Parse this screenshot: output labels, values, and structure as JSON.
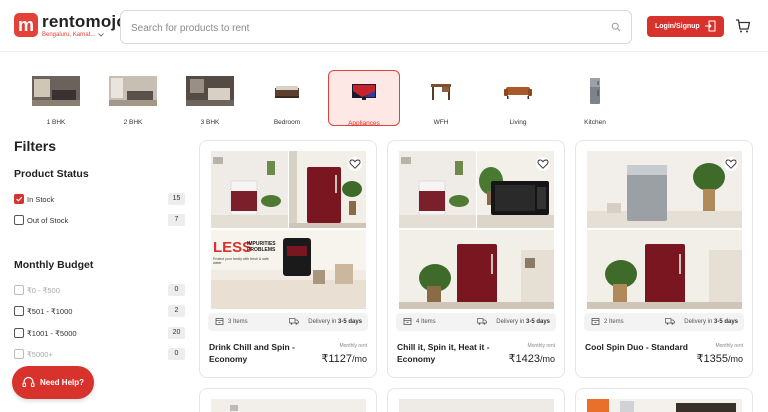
{
  "header": {
    "brand": "rentomojo",
    "logo_letter": "m",
    "city": "Bengaluru, Karnat...",
    "search_placeholder": "Search for products to rent",
    "login_label": "Login/Signup"
  },
  "categories": [
    {
      "label": "1 BHK"
    },
    {
      "label": "2 BHK"
    },
    {
      "label": "3 BHK"
    },
    {
      "label": "Bedroom"
    },
    {
      "label": "Appliances",
      "active": true
    },
    {
      "label": "WFH"
    },
    {
      "label": "Living"
    },
    {
      "label": "Kitchen"
    }
  ],
  "filters": {
    "title": "Filters",
    "product_status": {
      "title": "Product Status",
      "options": [
        {
          "label": "In Stock",
          "count": "15",
          "checked": true
        },
        {
          "label": "Out of Stock",
          "count": "7",
          "checked": false
        }
      ]
    },
    "monthly_budget": {
      "title": "Monthly Budget",
      "options": [
        {
          "label": "₹0 - ₹500",
          "count": "0",
          "disabled": true
        },
        {
          "label": "₹501 - ₹1000",
          "count": "2"
        },
        {
          "label": "₹1001 - ₹5000",
          "count": "20"
        },
        {
          "label": "₹5000+",
          "count": "0",
          "disabled": true
        }
      ]
    }
  },
  "help": {
    "label": "Need Help?"
  },
  "products": [
    {
      "name": "Drink Chill and Spin - Economy",
      "items": "3 Items",
      "delivery_prefix": "Delivery in",
      "delivery_days": "3-5 days",
      "monthly_label": "Monthly rent",
      "price": "₹1127",
      "per": "/mo",
      "banner_big": "LESS",
      "banner_small": "IMPURITIES PROBLEMS",
      "banner_sub": "Protect your family with fresh & safe water"
    },
    {
      "name": "Chill it, Spin it, Heat it - Economy",
      "items": "4 Items",
      "delivery_prefix": "Delivery in",
      "delivery_days": "3-5 days",
      "monthly_label": "Monthly rent",
      "price": "₹1423",
      "per": "/mo"
    },
    {
      "name": "Cool Spin Duo - Standard",
      "items": "2 Items",
      "delivery_prefix": "Delivery in",
      "delivery_days": "3-5 days",
      "monthly_label": "Monthly rent",
      "price": "₹1355",
      "per": "/mo"
    }
  ],
  "colors": {
    "accent": "#d7322b",
    "active_bg": "#fde8e6"
  }
}
